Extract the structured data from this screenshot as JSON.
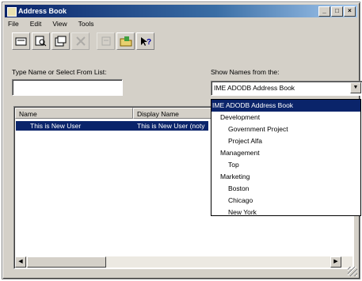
{
  "window": {
    "title": "Address Book",
    "controls": [
      "_",
      "□",
      "×"
    ]
  },
  "menu": [
    "File",
    "Edit",
    "View",
    "Tools"
  ],
  "toolbar": {
    "buttons": [
      {
        "icon": "new-entry-icon"
      },
      {
        "icon": "find-icon"
      },
      {
        "icon": "properties-icon"
      },
      {
        "icon": "delete-icon",
        "disabled": true
      },
      {
        "icon": "new-group-icon",
        "disabled": true
      },
      {
        "icon": "open-folder-icon"
      },
      {
        "icon": "help-icon"
      }
    ]
  },
  "search": {
    "label": "Type Name or Select From List:",
    "value": ""
  },
  "source": {
    "label": "Show Names from the:",
    "selected": "IME ADODB Address Book",
    "options": [
      {
        "text": "IME ADODB Address Book",
        "level": 0,
        "selected": true
      },
      {
        "text": "Development",
        "level": 1
      },
      {
        "text": "Government Project",
        "level": 2
      },
      {
        "text": "Project Alfa",
        "level": 2
      },
      {
        "text": "Management",
        "level": 1
      },
      {
        "text": "Top",
        "level": 2
      },
      {
        "text": "Marketing",
        "level": 1
      },
      {
        "text": "Boston",
        "level": 2
      },
      {
        "text": "Chicago",
        "level": 2
      },
      {
        "text": "New York",
        "level": 2
      }
    ]
  },
  "list": {
    "columns": [
      "Name",
      "Display Name"
    ],
    "rows": [
      {
        "name": "This is New User",
        "display_name": "This is New User (noty"
      }
    ]
  },
  "colors": {
    "selection": "#0a246a",
    "face": "#d4d0c8"
  }
}
